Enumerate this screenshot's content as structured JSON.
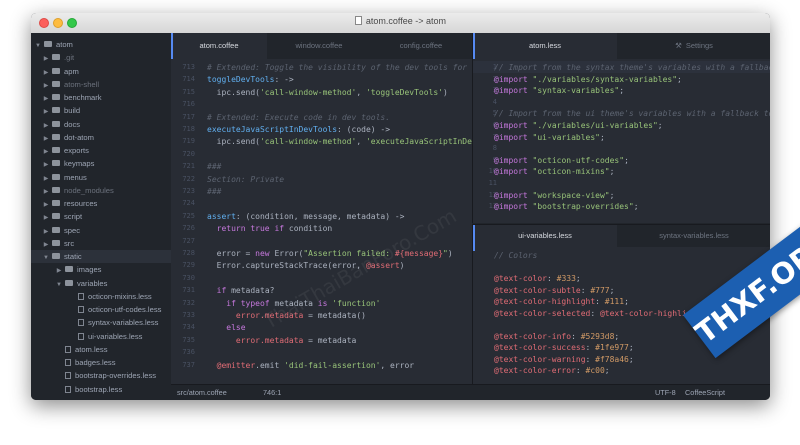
{
  "window": {
    "title": "atom.coffee -> atom"
  },
  "tree": {
    "root": "atom",
    "items": [
      {
        "label": ".git",
        "kind": "folder",
        "dim": true
      },
      {
        "label": "apm",
        "kind": "folder"
      },
      {
        "label": "atom-shell",
        "kind": "folder",
        "dim": true
      },
      {
        "label": "benchmark",
        "kind": "folder"
      },
      {
        "label": "build",
        "kind": "folder"
      },
      {
        "label": "docs",
        "kind": "folder"
      },
      {
        "label": "dot-atom",
        "kind": "folder"
      },
      {
        "label": "exports",
        "kind": "folder"
      },
      {
        "label": "keymaps",
        "kind": "folder"
      },
      {
        "label": "menus",
        "kind": "folder"
      },
      {
        "label": "node_modules",
        "kind": "folder",
        "dim": true
      },
      {
        "label": "resources",
        "kind": "folder"
      },
      {
        "label": "script",
        "kind": "folder"
      },
      {
        "label": "spec",
        "kind": "folder"
      },
      {
        "label": "src",
        "kind": "folder"
      },
      {
        "label": "static",
        "kind": "folder-open"
      },
      {
        "label": "images",
        "kind": "folder"
      },
      {
        "label": "variables",
        "kind": "folder-open"
      },
      {
        "label": "octicon-mixins.less",
        "kind": "file"
      },
      {
        "label": "octicon-utf-codes.less",
        "kind": "file"
      },
      {
        "label": "syntax-variables.less",
        "kind": "file"
      },
      {
        "label": "ui-variables.less",
        "kind": "file"
      },
      {
        "label": "atom.less",
        "kind": "file"
      },
      {
        "label": "badges.less",
        "kind": "file"
      },
      {
        "label": "bootstrap-overrides.less",
        "kind": "file"
      },
      {
        "label": "bootstrap.less",
        "kind": "file"
      }
    ]
  },
  "left_pane": {
    "tabs": [
      "atom.coffee",
      "window.coffee",
      "config.coffee"
    ],
    "line_numbers": [
      "713",
      "714",
      "715",
      "716",
      "717",
      "718",
      "719",
      "720",
      "721",
      "722",
      "723",
      "724",
      "725",
      "726",
      "727",
      "728",
      "729",
      "730",
      "731",
      "732",
      "733",
      "734",
      "735",
      "736",
      "737"
    ],
    "lines": [
      [
        [
          "cm",
          "# Extended: Toggle the visibility of the dev tools for the"
        ]
      ],
      [
        [
          "fn",
          "toggleDevTools"
        ],
        [
          "pl",
          ": ->"
        ]
      ],
      [
        [
          "pl",
          "  ipc.send("
        ],
        [
          "st",
          "'call-window-method'"
        ],
        [
          "pl",
          ", "
        ],
        [
          "st",
          "'toggleDevTools'"
        ],
        [
          "pl",
          ")"
        ]
      ],
      [
        [
          "pl",
          ""
        ]
      ],
      [
        [
          "cm",
          "# Extended: Execute code in dev tools."
        ]
      ],
      [
        [
          "fn",
          "executeJavaScriptInDevTools"
        ],
        [
          "pl",
          ": (code) ->"
        ]
      ],
      [
        [
          "pl",
          "  ipc.send("
        ],
        [
          "st",
          "'call-window-method'"
        ],
        [
          "pl",
          ", "
        ],
        [
          "st",
          "'executeJavaScriptInDevToo"
        ]
      ],
      [
        [
          "pl",
          ""
        ]
      ],
      [
        [
          "cm",
          "###"
        ]
      ],
      [
        [
          "cm",
          "Section: Private"
        ]
      ],
      [
        [
          "cm",
          "###"
        ]
      ],
      [
        [
          "pl",
          ""
        ]
      ],
      [
        [
          "fn",
          "assert"
        ],
        [
          "pl",
          ": (condition, message, metadata) ->"
        ]
      ],
      [
        [
          "pl",
          "  "
        ],
        [
          "kw",
          "return true if"
        ],
        [
          "pl",
          " condition"
        ]
      ],
      [
        [
          "pl",
          ""
        ]
      ],
      [
        [
          "pl",
          "  error = "
        ],
        [
          "kw",
          "new"
        ],
        [
          "pl",
          " Error("
        ],
        [
          "st",
          "\"Assertion failed: "
        ],
        [
          "va",
          "#{message}"
        ],
        [
          "st",
          "\""
        ],
        [
          "pl",
          ")"
        ]
      ],
      [
        [
          "pl",
          "  Error.captureStackTrace(error, "
        ],
        [
          "va",
          "@assert"
        ],
        [
          "pl",
          ")"
        ]
      ],
      [
        [
          "pl",
          ""
        ]
      ],
      [
        [
          "pl",
          "  "
        ],
        [
          "kw",
          "if"
        ],
        [
          "pl",
          " metadata?"
        ]
      ],
      [
        [
          "pl",
          "    "
        ],
        [
          "kw",
          "if typeof"
        ],
        [
          "pl",
          " metadata "
        ],
        [
          "kw",
          "is"
        ],
        [
          "pl",
          " "
        ],
        [
          "st",
          "'function'"
        ]
      ],
      [
        [
          "pl",
          "      "
        ],
        [
          "va",
          "error.metadata"
        ],
        [
          "pl",
          " = metadata()"
        ]
      ],
      [
        [
          "pl",
          "    "
        ],
        [
          "kw",
          "else"
        ]
      ],
      [
        [
          "pl",
          "      "
        ],
        [
          "va",
          "error.metadata"
        ],
        [
          "pl",
          " = metadata"
        ]
      ],
      [
        [
          "pl",
          ""
        ]
      ],
      [
        [
          "pl",
          "  "
        ],
        [
          "va",
          "@emitter"
        ],
        [
          "pl",
          ".emit "
        ],
        [
          "st",
          "'did-fail-assertion'"
        ],
        [
          "pl",
          ", error"
        ]
      ],
      [
        [
          "pl",
          ""
        ]
      ],
      [
        [
          "pl",
          "  "
        ],
        [
          "nu",
          "false"
        ]
      ]
    ],
    "current_line": 0
  },
  "right_top": {
    "tabs": [
      "atom.less",
      "Settings"
    ],
    "line_numbers": [
      "1",
      "2",
      "3",
      "4",
      "5",
      "6",
      "7",
      "8",
      "9",
      "10",
      "11",
      "12",
      "13",
      "14"
    ],
    "lines": [
      [
        [
          "cm",
          "// Import from the syntax theme's variables with a fallback t"
        ]
      ],
      [
        [
          "kw",
          "@import"
        ],
        [
          "pl",
          " "
        ],
        [
          "st",
          "\"./variables/syntax-variables\""
        ],
        [
          "pl",
          ";"
        ]
      ],
      [
        [
          "kw",
          "@import"
        ],
        [
          "pl",
          " "
        ],
        [
          "st",
          "\"syntax-variables\""
        ],
        [
          "pl",
          ";"
        ]
      ],
      [
        [
          "pl",
          ""
        ]
      ],
      [
        [
          "cm",
          "// Import from the ui theme's variables with a fallback to ./"
        ]
      ],
      [
        [
          "kw",
          "@import"
        ],
        [
          "pl",
          " "
        ],
        [
          "st",
          "\"./variables/ui-variables\""
        ],
        [
          "pl",
          ";"
        ]
      ],
      [
        [
          "kw",
          "@import"
        ],
        [
          "pl",
          " "
        ],
        [
          "st",
          "\"ui-variables\""
        ],
        [
          "pl",
          ";"
        ]
      ],
      [
        [
          "pl",
          ""
        ]
      ],
      [
        [
          "kw",
          "@import"
        ],
        [
          "pl",
          " "
        ],
        [
          "st",
          "\"octicon-utf-codes\""
        ],
        [
          "pl",
          ";"
        ]
      ],
      [
        [
          "kw",
          "@import"
        ],
        [
          "pl",
          " "
        ],
        [
          "st",
          "\"octicon-mixins\""
        ],
        [
          "pl",
          ";"
        ]
      ],
      [
        [
          "pl",
          ""
        ]
      ],
      [
        [
          "kw",
          "@import"
        ],
        [
          "pl",
          " "
        ],
        [
          "st",
          "\"workspace-view\""
        ],
        [
          "pl",
          ";"
        ]
      ],
      [
        [
          "kw",
          "@import"
        ],
        [
          "pl",
          " "
        ],
        [
          "st",
          "\"bootstrap-overrides\""
        ],
        [
          "pl",
          ";"
        ]
      ]
    ]
  },
  "right_bottom": {
    "tabs": [
      "ui-variables.less",
      "syntax-variables.less"
    ],
    "lines": [
      [
        [
          "cm",
          "// Colors"
        ]
      ],
      [
        [
          "pl",
          ""
        ]
      ],
      [
        [
          "va",
          "@text-color"
        ],
        [
          "pl",
          ": "
        ],
        [
          "nu",
          "#333"
        ],
        [
          "pl",
          ";"
        ]
      ],
      [
        [
          "va",
          "@text-color-subtle"
        ],
        [
          "pl",
          ": "
        ],
        [
          "nu",
          "#777"
        ],
        [
          "pl",
          ";"
        ]
      ],
      [
        [
          "va",
          "@text-color-highlight"
        ],
        [
          "pl",
          ": "
        ],
        [
          "nu",
          "#111"
        ],
        [
          "pl",
          ";"
        ]
      ],
      [
        [
          "va",
          "@text-color-selected"
        ],
        [
          "pl",
          ": "
        ],
        [
          "va",
          "@text-color-highlight"
        ],
        [
          "pl",
          ";"
        ]
      ],
      [
        [
          "pl",
          ""
        ]
      ],
      [
        [
          "va",
          "@text-color-info"
        ],
        [
          "pl",
          ": "
        ],
        [
          "nu",
          "#5293d8"
        ],
        [
          "pl",
          ";"
        ]
      ],
      [
        [
          "va",
          "@text-color-success"
        ],
        [
          "pl",
          ": "
        ],
        [
          "nu",
          "#1fe977"
        ],
        [
          "pl",
          ";"
        ]
      ],
      [
        [
          "va",
          "@text-color-warning"
        ],
        [
          "pl",
          ": "
        ],
        [
          "nu",
          "#f78a46"
        ],
        [
          "pl",
          ";"
        ]
      ],
      [
        [
          "va",
          "@text-color-error"
        ],
        [
          "pl",
          ": "
        ],
        [
          "nu",
          "#c00"
        ],
        [
          "pl",
          ";"
        ]
      ],
      [
        [
          "pl",
          ""
        ]
      ],
      [
        [
          "va",
          "@background-color-info"
        ],
        [
          "pl",
          ": "
        ],
        [
          "nu",
          "#0098ff"
        ],
        [
          "pl",
          ";"
        ]
      ]
    ]
  },
  "status_bar": {
    "file": "src/atom.coffee",
    "position": "746:1",
    "encoding": "UTF-8",
    "grammar": "CoffeeScript"
  },
  "watermark": "ThaiThaiBanForo.Com",
  "badge": "THXF.ORG"
}
